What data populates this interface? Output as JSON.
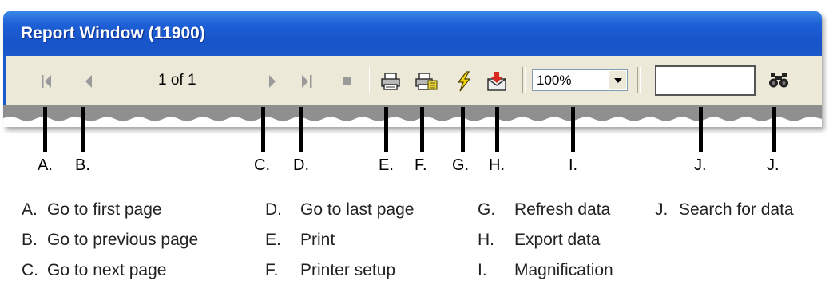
{
  "window": {
    "title": "Report Window (11900)",
    "page_indicator": "1 of 1",
    "zoom_value": "100%",
    "search_value": ""
  },
  "icons": {
    "first_page": "first-page-icon",
    "prev_page": "previous-page-icon",
    "next_page": "next-page-icon",
    "last_page": "last-page-icon",
    "stop": "stop-icon",
    "print": "printer-icon",
    "printer_setup": "printer-setup-icon",
    "refresh": "lightning-icon",
    "export": "export-envelope-icon",
    "search": "binoculars-icon"
  },
  "callouts": [
    "A.",
    "B.",
    "C.",
    "D.",
    "E.",
    "F.",
    "G.",
    "H.",
    "I.",
    "J.",
    "J."
  ],
  "legend": [
    {
      "letter": "A.",
      "text": "Go to first page"
    },
    {
      "letter": "B.",
      "text": "Go to previous page"
    },
    {
      "letter": "C.",
      "text": "Go to next page"
    },
    {
      "letter": "D.",
      "text": "Go to last page"
    },
    {
      "letter": "E.",
      "text": "Print"
    },
    {
      "letter": "F.",
      "text": "Printer setup"
    },
    {
      "letter": "G.",
      "text": "Refresh data"
    },
    {
      "letter": "H.",
      "text": "Export data"
    },
    {
      "letter": "I.",
      "text": "Magnification"
    },
    {
      "letter": "J.",
      "text": "Search for data"
    }
  ],
  "colors": {
    "titlebar": "#1b59cc",
    "toolbar": "#ece9d8",
    "content": "#8f8f8f",
    "disabled_icon": "#9a9a9a"
  }
}
